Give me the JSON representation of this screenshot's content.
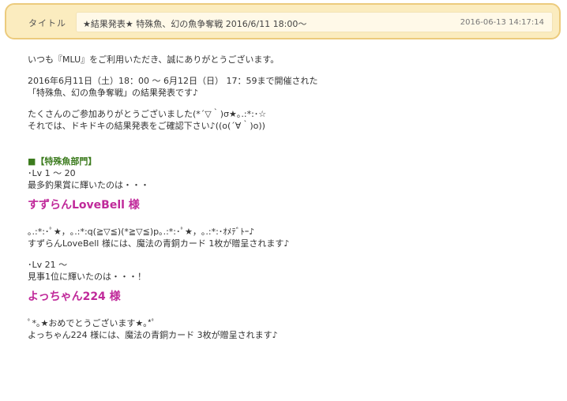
{
  "header": {
    "label": "タイトル",
    "title": "★結果発表★ 特殊魚、幻の魚争奪戦 2016/6/11 18:00～",
    "datetime": "2016-06-13 14:17:14"
  },
  "content": {
    "intro": "いつも『MLU』をご利用いただき、誠にありがとうございます。",
    "period_line1": "2016年6月11日（土）18：00 ～ 6月12日（日） 17：59まで開催された",
    "period_line2": "「特殊魚、幻の魚争奪戦」の結果発表です♪",
    "thanks_line1": "たくさんのご参加ありがとうございました(*´▽｀)σ★｡.:*:･☆",
    "thanks_line2": "それでは、ドキドキの結果発表をご確認下さい♪((o(´∀｀)o))",
    "section_title": "■【特殊魚部門】",
    "group1": {
      "level": "･Lv 1 ～ 20",
      "caption": "最多釣果賞に輝いたのは・・・",
      "winner": "すずらんLoveBell 様",
      "cheer": "｡.:*:･ﾟ★，｡.:*:q(≧▽≦)(*≧▽≦)p｡.:*:･ﾟ★，｡.:*:･ｵﾒﾃﾞﾄｰ♪",
      "prize": "すずらんLoveBell 様には、魔法の青銅カード 1枚が贈呈されます♪"
    },
    "group2": {
      "level": "･Lv 21 ～",
      "caption": "見事1位に輝いたのは・・・！",
      "winner": "よっちゃん224 様",
      "cheer": "ﾟ*｡★おめでとうございます★｡*ﾟ",
      "prize": "よっちゃん224 様には、魔法の青銅カード 3枚が贈呈されます♪"
    }
  },
  "colors": {
    "title_bar_bg": "#fbecbf",
    "title_bar_border": "#eccb7d",
    "section_heading": "#3c7b1e",
    "winner_name": "#c0299a"
  }
}
